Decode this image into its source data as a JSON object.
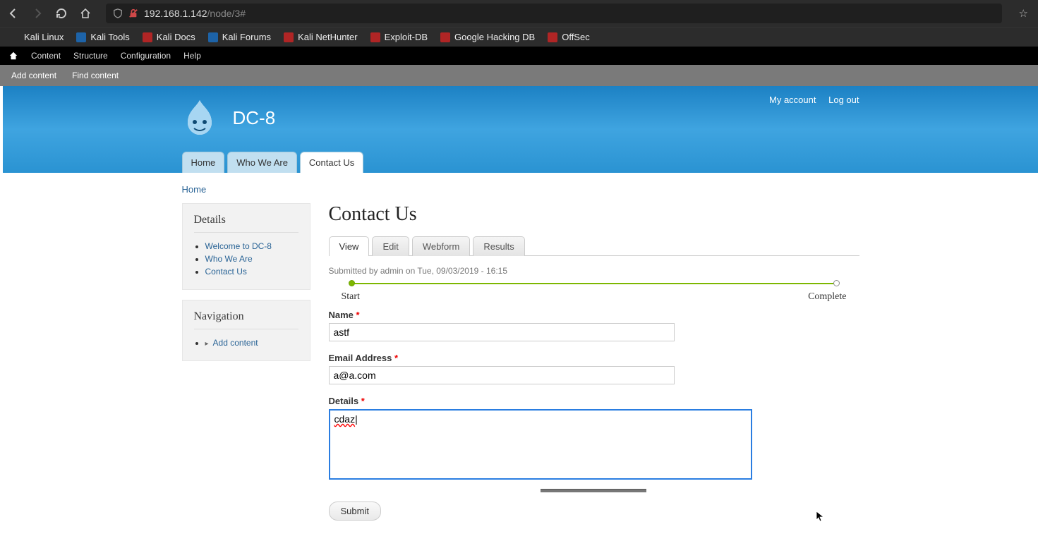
{
  "browser": {
    "url_host": "192.168.1.142",
    "url_path": "/node/3#",
    "bookmarks": [
      {
        "label": "Kali Linux",
        "color": "#2c2c2c"
      },
      {
        "label": "Kali Tools",
        "color": "#1d63a8"
      },
      {
        "label": "Kali Docs",
        "color": "#b02525"
      },
      {
        "label": "Kali Forums",
        "color": "#1d63a8"
      },
      {
        "label": "Kali NetHunter",
        "color": "#b02525"
      },
      {
        "label": "Exploit-DB",
        "color": "#b02525"
      },
      {
        "label": "Google Hacking DB",
        "color": "#b02525"
      },
      {
        "label": "OffSec",
        "color": "#b02525"
      }
    ]
  },
  "admin": {
    "top": [
      "Content",
      "Structure",
      "Configuration",
      "Help"
    ],
    "sub": {
      "add_content": "Add content",
      "find_content": "Find content"
    }
  },
  "site": {
    "name": "DC-8",
    "user_links": {
      "account": "My account",
      "logout": "Log out"
    },
    "primary_tabs": [
      {
        "label": "Home",
        "active": false
      },
      {
        "label": "Who We Are",
        "active": false
      },
      {
        "label": "Contact Us",
        "active": true
      }
    ],
    "breadcrumb": "Home"
  },
  "sidebar": {
    "details": {
      "title": "Details",
      "items": [
        "Welcome to DC-8",
        "Who We Are",
        "Contact Us"
      ]
    },
    "nav": {
      "title": "Navigation",
      "items": [
        "Add content"
      ]
    }
  },
  "main": {
    "title": "Contact Us",
    "tabs": [
      "View",
      "Edit",
      "Webform",
      "Results"
    ],
    "active_tab": "View",
    "submitted": "Submitted by admin on Tue, 09/03/2019 - 16:15",
    "progress": {
      "start": "Start",
      "end": "Complete"
    },
    "form": {
      "name": {
        "label": "Name",
        "value": "astf"
      },
      "email": {
        "label": "Email Address",
        "value": "a@a.com"
      },
      "details": {
        "label": "Details",
        "value": "cdaz"
      },
      "submit": "Submit"
    }
  }
}
